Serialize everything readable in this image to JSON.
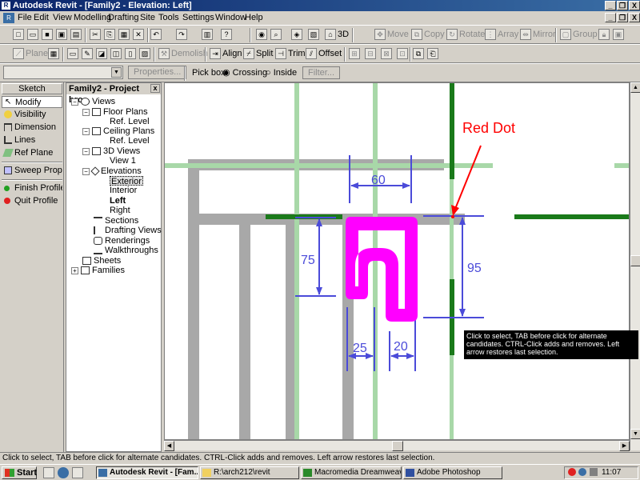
{
  "window": {
    "title": "Autodesk Revit - [Family2 - Elevation: Left]",
    "app_icon": "revit-app-icon",
    "controls": [
      "_",
      "❐",
      "X"
    ],
    "doc_controls": [
      "_",
      "❐",
      "X"
    ]
  },
  "menu": [
    "File",
    "Edit",
    "View",
    "Modelling",
    "Drafting",
    "Site",
    "Tools",
    "Settings",
    "Window",
    "Help"
  ],
  "toolbar1": {
    "tools_enabled": [
      "3D"
    ],
    "tools_disabled": [
      "Move",
      "Copy",
      "Rotate",
      "Array",
      "Mirror",
      "Group"
    ]
  },
  "toolbar2": {
    "plane": "Plane",
    "demolish": "Demolish",
    "align": "Align",
    "split": "Split",
    "trim": "Trim",
    "offset": "Offset"
  },
  "options_bar": {
    "properties": "Properties...",
    "pick_box_label": "Pick box:",
    "crossing": "Crossing",
    "inside": "Inside",
    "filter": "Filter..."
  },
  "sketch": {
    "header": "Sketch",
    "items": [
      {
        "label": "Modify",
        "icon": "arrow-cursor-icon"
      },
      {
        "label": "Visibility",
        "icon": "lightbulb-icon"
      },
      {
        "label": "Dimension",
        "icon": "dimension-icon"
      },
      {
        "label": "Lines",
        "icon": "lines-icon"
      },
      {
        "label": "Ref Plane",
        "icon": "ref-plane-icon"
      },
      {
        "label": "Sweep Properties",
        "icon": "sweep-properties-icon"
      },
      {
        "label": "Finish Profile",
        "icon": "finish-profile-icon"
      },
      {
        "label": "Quit Profile",
        "icon": "quit-profile-icon"
      }
    ]
  },
  "browser": {
    "title": "Family2 - Project bro...",
    "tree": {
      "views": "Views",
      "floor_plans": "Floor Plans",
      "fp_ref_level": "Ref. Level",
      "ceiling_plans": "Ceiling Plans",
      "cp_ref_level": "Ref. Level",
      "views_3d": "3D Views",
      "view1": "View 1",
      "elevations": "Elevations",
      "exterior": "Exterior",
      "interior": "Interior",
      "left": "Left",
      "right": "Right",
      "sections": "Sections",
      "drafting_views": "Drafting Views",
      "renderings": "Renderings",
      "walkthroughs": "Walkthroughs",
      "sheets": "Sheets",
      "families": "Families"
    }
  },
  "drawing": {
    "annotation": "Red Dot",
    "dimensions": {
      "d60": "60",
      "d75": "75",
      "d95": "95",
      "d25": "25",
      "d20": "20"
    },
    "colors": {
      "profile": "#ff00ff",
      "dimension": "#4b4bd9",
      "reference": "#a8d8a8",
      "reference_active": "#1a7a1a",
      "structure": "#a8a8a8",
      "annotation": "#ff0000"
    }
  },
  "tooltip": "Click to select, TAB before click for alternate candidates. CTRL-Click adds and removes. Left arrow restores last selection.",
  "status": "Click to select, TAB before click for alternate candidates. CTRL-Click adds and removes. Left arrow restores last selection.",
  "taskbar": {
    "start": "Start",
    "tasks": [
      {
        "label": "Autodesk Revit - [Fam...",
        "active": true
      },
      {
        "label": "R:\\arch212\\revit",
        "active": false
      },
      {
        "label": "Macromedia Dreamweave...",
        "active": false
      },
      {
        "label": "Adobe Photoshop",
        "active": false
      }
    ],
    "clock": "11:07 a.m."
  }
}
